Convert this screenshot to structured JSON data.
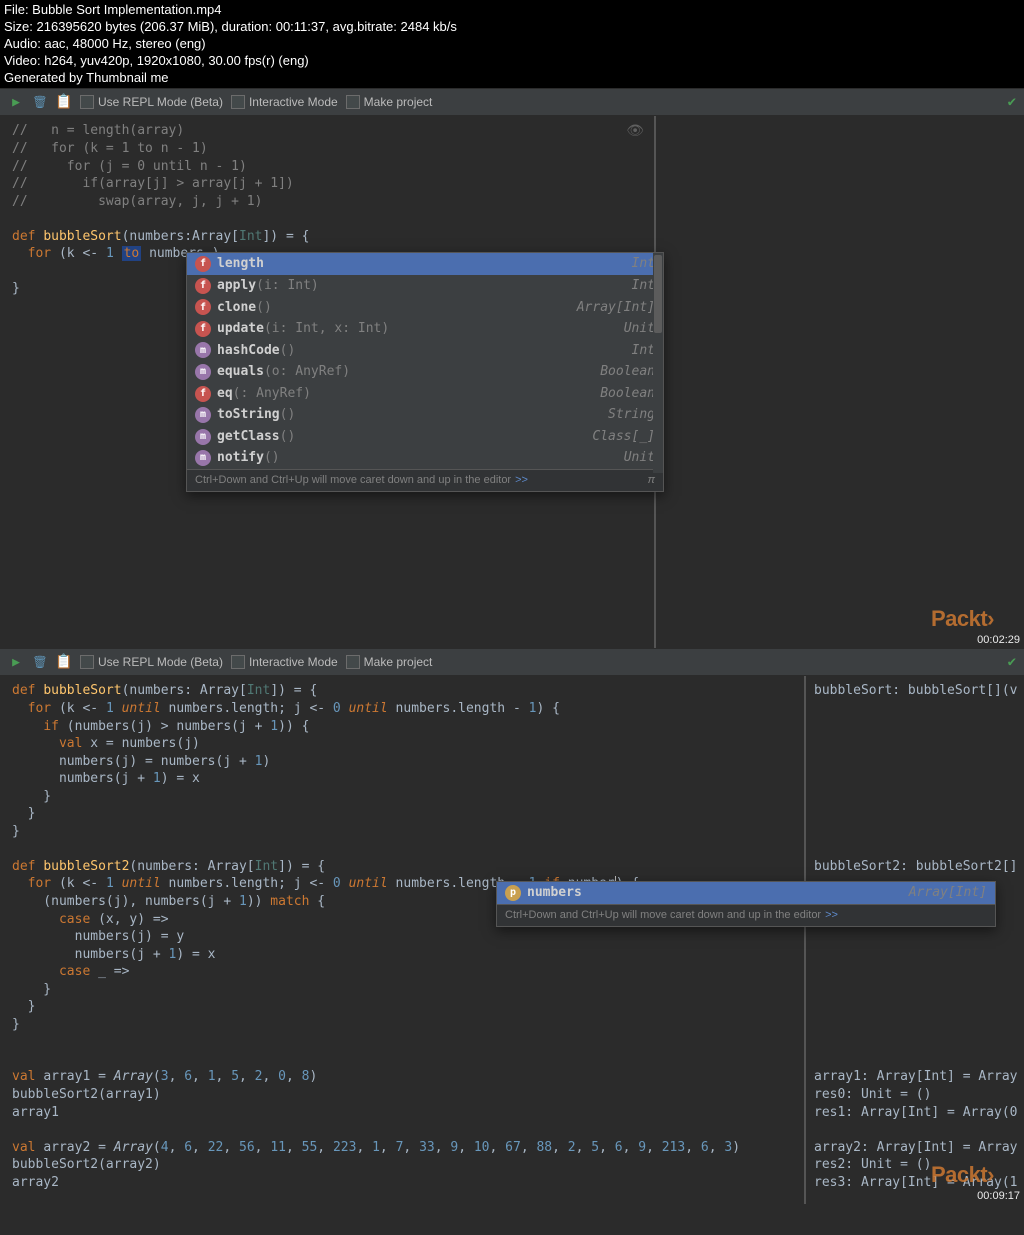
{
  "file_info": {
    "line1": "File: Bubble Sort Implementation.mp4",
    "line2": "Size: 216395620 bytes (206.37 MiB), duration: 00:11:37, avg.bitrate: 2484 kb/s",
    "line3": "Audio: aac, 48000 Hz, stereo (eng)",
    "line4": "Video: h264, yuv420p, 1920x1080, 30.00 fps(r) (eng)",
    "line5": "Generated by Thumbnail me"
  },
  "toolbar": {
    "repl_mode": "Use REPL Mode (Beta)",
    "interactive": "Interactive Mode",
    "make_project": "Make project"
  },
  "panel1": {
    "code_comments": [
      "//   n = length(array)",
      "//   for (k = 1 to n - 1)",
      "//     for (j = 0 until n - 1)",
      "//       if(array[j] > array[j + 1])",
      "//         swap(array, j, j + 1)"
    ],
    "def_line_pre": "def ",
    "def_name": "bubbleSort",
    "def_params": "(numbers:Array[",
    "def_type": "Int",
    "def_close": "]) = {",
    "for_line": "  for (k <- 1 to numbers.)",
    "close_brace": "}",
    "autocomplete": {
      "items": [
        {
          "badge": "f",
          "name": "length",
          "params": "",
          "type": "Int",
          "selected": true
        },
        {
          "badge": "f",
          "name": "apply",
          "params": "(i: Int)",
          "type": "Int"
        },
        {
          "badge": "f",
          "name": "clone",
          "params": "()",
          "type": "Array[Int]"
        },
        {
          "badge": "f",
          "name": "update",
          "params": "(i: Int, x: Int)",
          "type": "Unit"
        },
        {
          "badge": "m",
          "name": "hashCode",
          "params": "()",
          "type": "Int"
        },
        {
          "badge": "m",
          "name": "equals",
          "params": "(o: AnyRef)",
          "type": "Boolean"
        },
        {
          "badge": "f",
          "name": "eq",
          "params": "(: AnyRef)",
          "type": "Boolean"
        },
        {
          "badge": "m",
          "name": "toString",
          "params": "()",
          "type": "String"
        },
        {
          "badge": "m",
          "name": "getClass",
          "params": "()",
          "type": "Class[_]"
        },
        {
          "badge": "m",
          "name": "notify",
          "params": "()",
          "type": "Unit"
        }
      ],
      "footer_text": "Ctrl+Down and Ctrl+Up will move caret down and up in the editor",
      "footer_link": ">>",
      "pi": "π"
    },
    "watermark": "Packt›",
    "timestamp": "00:02:29"
  },
  "panel2": {
    "left_code": {
      "l1": "def bubbleSort(numbers: Array[Int]) = {",
      "l2": "  for (k <- 1 until numbers.length; j <- 0 until numbers.length - 1) {",
      "l3": "    if (numbers(j) > numbers(j + 1)) {",
      "l4": "      val x = numbers(j)",
      "l5": "      numbers(j) = numbers(j + 1)",
      "l6": "      numbers(j + 1) = x",
      "l7": "    }",
      "l8": "  }",
      "l9": "}",
      "l10": "",
      "l11": "def bubbleSort2(numbers: Array[Int]) = {",
      "l12": "  for (k <- 1 until numbers.length; j <- 0 until numbers.length - 1 if number) {",
      "l13": "    (numbers(j), numbers(j + 1)) match {",
      "l14": "      case (x, y) =>",
      "l15": "        numbers(j) = y",
      "l16": "        numbers(j + 1) = x",
      "l17": "      case _ =>",
      "l18": "    }",
      "l19": "  }",
      "l20": "}",
      "l21": "",
      "l22": "",
      "l23": "val array1 = Array(3, 6, 1, 5, 2, 0, 8)",
      "l24": "bubbleSort2(array1)",
      "l25": "array1",
      "l26": "",
      "l27": "val array2 = Array(4, 6, 22, 56, 11, 55, 223, 1, 7, 33, 9, 10, 67, 88, 2, 5, 6, 9, 213, 6, 3)",
      "l28": "bubbleSort2(array2)",
      "l29": "array2"
    },
    "right_code": {
      "r1": "bubbleSort: bubbleSort[](v",
      "r2": "bubbleSort2: bubbleSort2[]",
      "r3": "array1: Array[Int] = Array",
      "r4": "res0: Unit = ()",
      "r5": "res1: Array[Int] = Array(0",
      "r6": "array2: Array[Int] = Array",
      "r7": "res2: Unit = ()",
      "r8": "res3: Array[Int] = Array(1"
    },
    "small_ac": {
      "name": "numbers",
      "type": "Array[Int]",
      "footer_text": "Ctrl+Down and Ctrl+Up will move caret down and up in the editor",
      "footer_link": ">>"
    },
    "watermark": "Packt›",
    "timestamp": "00:09:17"
  }
}
